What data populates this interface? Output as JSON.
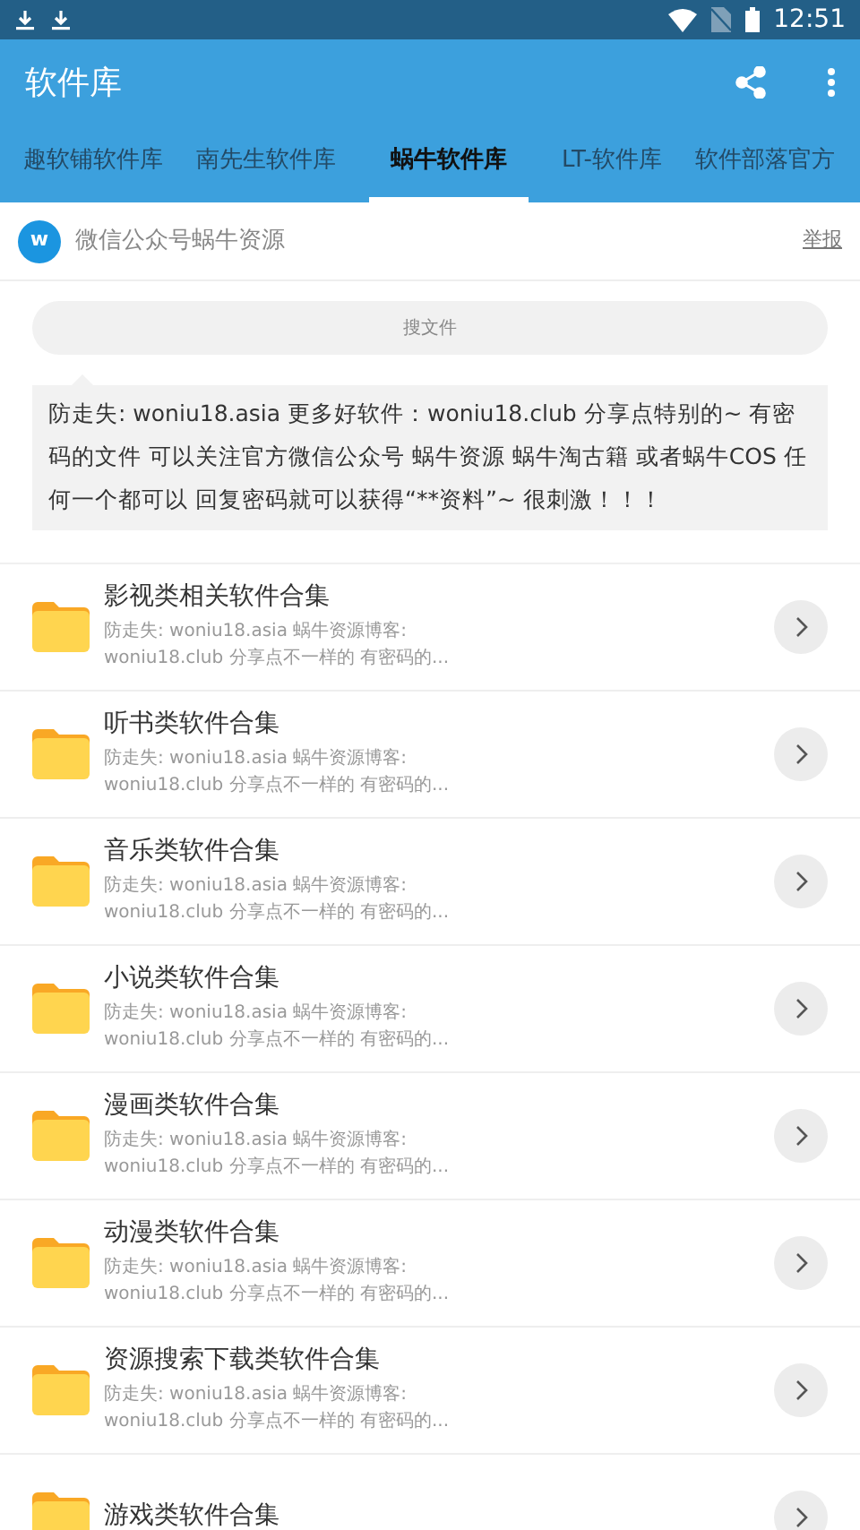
{
  "status_bar": {
    "time": "12:51"
  },
  "app_bar": {
    "title": "软件库"
  },
  "tabs": [
    {
      "label": "趣软铺软件库",
      "selected": false
    },
    {
      "label": "南先生软件库",
      "selected": false
    },
    {
      "label": "蜗牛软件库",
      "selected": true
    },
    {
      "label": "LT-软件库",
      "selected": false
    },
    {
      "label": "软件部落官方",
      "selected": false
    }
  ],
  "publisher": {
    "avatar_letter": "w",
    "name": "微信公众号蜗牛资源",
    "report": "举报"
  },
  "search": {
    "placeholder": "搜文件"
  },
  "notice": "防走失: woniu18.asia 更多好软件：woniu18.club 分享点特别的~ 有密码的文件 可以关注官方微信公众号 蜗牛资源 蜗牛淘古籍 或者蜗牛COS 任何一个都可以 回复密码就可以获得“**资料”~ 很刺激！！！",
  "folders": [
    {
      "title": "影视类相关软件合集",
      "description": "防走失: woniu18.asia 蜗牛资源博客:\nwoniu18.club 分享点不一样的 有密码的..."
    },
    {
      "title": "听书类软件合集",
      "description": "防走失: woniu18.asia 蜗牛资源博客:\nwoniu18.club 分享点不一样的 有密码的..."
    },
    {
      "title": "音乐类软件合集",
      "description": "防走失: woniu18.asia 蜗牛资源博客:\nwoniu18.club 分享点不一样的 有密码的..."
    },
    {
      "title": "小说类软件合集",
      "description": "防走失: woniu18.asia 蜗牛资源博客:\nwoniu18.club 分享点不一样的 有密码的..."
    },
    {
      "title": "漫画类软件合集",
      "description": "防走失: woniu18.asia 蜗牛资源博客:\nwoniu18.club 分享点不一样的 有密码的..."
    },
    {
      "title": "动漫类软件合集",
      "description": "防走失: woniu18.asia 蜗牛资源博客:\nwoniu18.club 分享点不一样的 有密码的..."
    },
    {
      "title": "资源搜索下载类软件合集",
      "description": "防走失: woniu18.asia 蜗牛资源博客:\nwoniu18.club 分享点不一样的 有密码的..."
    },
    {
      "title": "游戏类软件合集"
    }
  ]
}
